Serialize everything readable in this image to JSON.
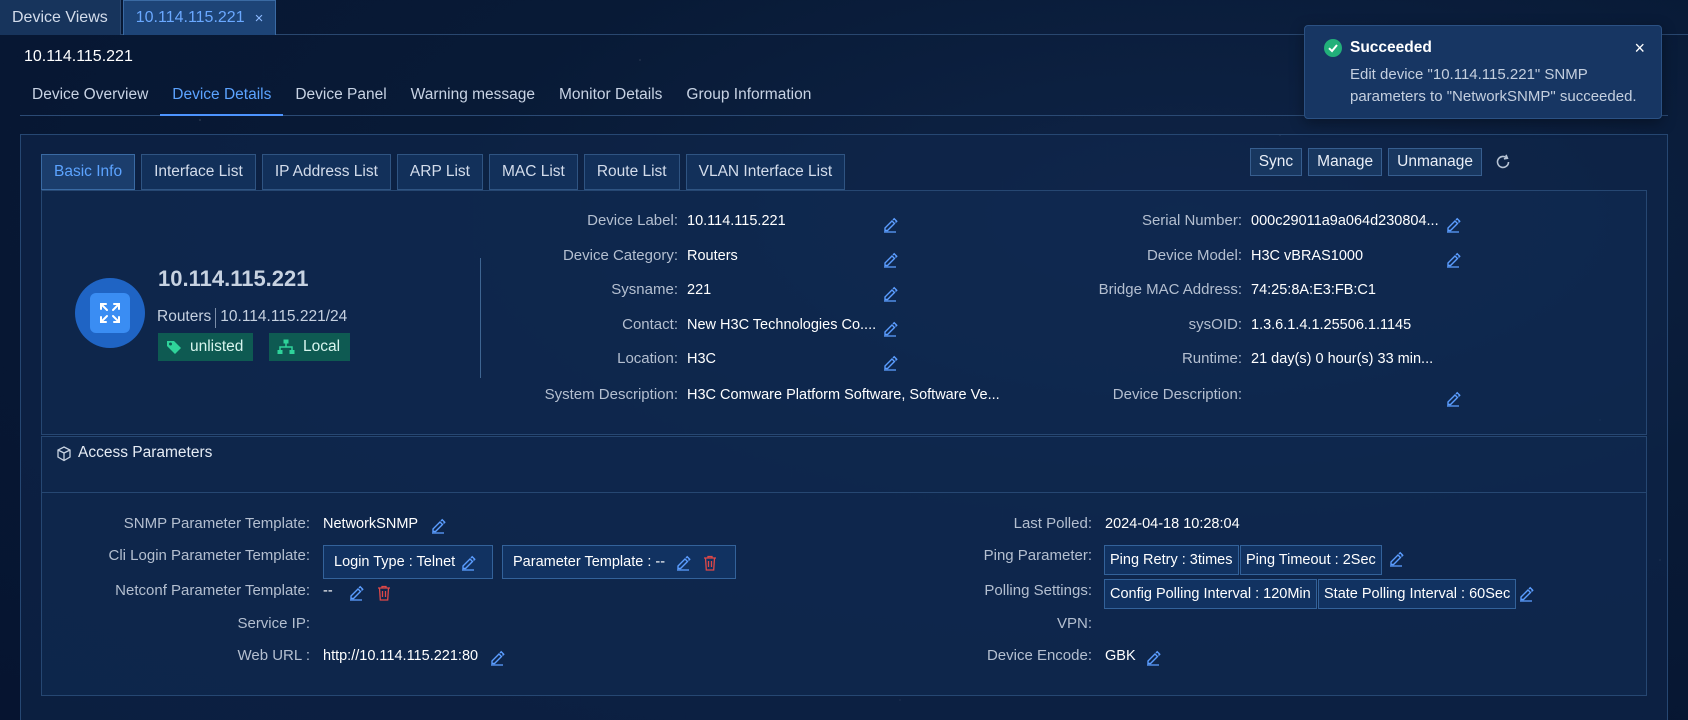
{
  "top_tabs": [
    {
      "label": "Device Views"
    },
    {
      "label": "10.114.115.221",
      "close": "×"
    }
  ],
  "page_title": "10.114.115.221",
  "sub_tabs": [
    "Device Overview",
    "Device Details",
    "Device Panel",
    "Warning message",
    "Monitor Details",
    "Group Information"
  ],
  "inner_tabs": [
    "Basic Info",
    "Interface List",
    "IP Address List",
    "ARP List",
    "MAC List",
    "Route List",
    "VLAN Interface List"
  ],
  "actions": {
    "sync": "Sync",
    "manage": "Manage",
    "unmanage": "Unmanage"
  },
  "device": {
    "name": "10.114.115.221",
    "category": "Routers",
    "ip_mask": "10.114.115.221/24",
    "tag_unlisted": "unlisted",
    "tag_local": "Local"
  },
  "basic_left": [
    {
      "label": "Device Label:",
      "value": "10.114.115.221",
      "editable": true
    },
    {
      "label": "Device Category:",
      "value": "Routers",
      "editable": true
    },
    {
      "label": "Sysname:",
      "value": "221",
      "editable": true
    },
    {
      "label": "Contact:",
      "value": "New H3C Technologies Co....",
      "editable": true
    },
    {
      "label": "Location:",
      "value": "H3C",
      "editable": true
    },
    {
      "label": "System Description:",
      "value": "H3C Comware Platform Software, Software Ve...",
      "editable": false
    }
  ],
  "basic_right": [
    {
      "label": "Serial Number:",
      "value": "000c29011a9a064d230804...",
      "editable": true
    },
    {
      "label": "Device Model:",
      "value": "H3C vBRAS1000",
      "editable": true
    },
    {
      "label": "Bridge MAC Address:",
      "value": "74:25:8A:E3:FB:C1",
      "editable": false
    },
    {
      "label": "sysOID:",
      "value": "1.3.6.1.4.1.25506.1.1145",
      "editable": false
    },
    {
      "label": "Runtime:",
      "value": "21 day(s) 0 hour(s) 33 min...",
      "editable": false
    },
    {
      "label": "Device Description:",
      "value": "",
      "editable": true
    }
  ],
  "access": {
    "title": "Access Parameters",
    "snmp_label": "SNMP Parameter Template:",
    "snmp_value": "NetworkSNMP",
    "cli_label": "Cli Login Parameter Template:",
    "cli_login_type": "Login Type : Telnet",
    "cli_param_template": "Parameter Template : --",
    "netconf_label": "Netconf Parameter Template:",
    "netconf_value": "--",
    "service_ip_label": "Service IP:",
    "service_ip_value": "",
    "web_url_label": "Web URL :",
    "web_url_value": "http://10.114.115.221:80",
    "last_polled_label": "Last Polled:",
    "last_polled_value": "2024-04-18 10:28:04",
    "ping_label": "Ping Parameter:",
    "ping_retry": "Ping Retry : 3times",
    "ping_timeout": "Ping Timeout : 2Sec",
    "polling_label": "Polling Settings:",
    "config_polling": "Config Polling Interval : 120Min",
    "state_polling": "State Polling Interval : 60Sec",
    "vpn_label": "VPN:",
    "vpn_value": "",
    "encode_label": "Device Encode:",
    "encode_value": "GBK"
  },
  "toast": {
    "title": "Succeeded",
    "message": "Edit device \"10.114.115.221\" SNMP parameters to \"NetworkSNMP\" succeeded.",
    "close": "×"
  },
  "colors": {
    "accent": "#4d94ff",
    "tag_bg": "#0e5a52",
    "success": "#22b07a",
    "danger": "#e04848"
  },
  "icons": [
    "check-circle-icon",
    "close-icon",
    "edit-icon",
    "trash-icon",
    "refresh-icon",
    "tag-icon",
    "hierarchy-icon",
    "router-icon",
    "cube-icon"
  ]
}
